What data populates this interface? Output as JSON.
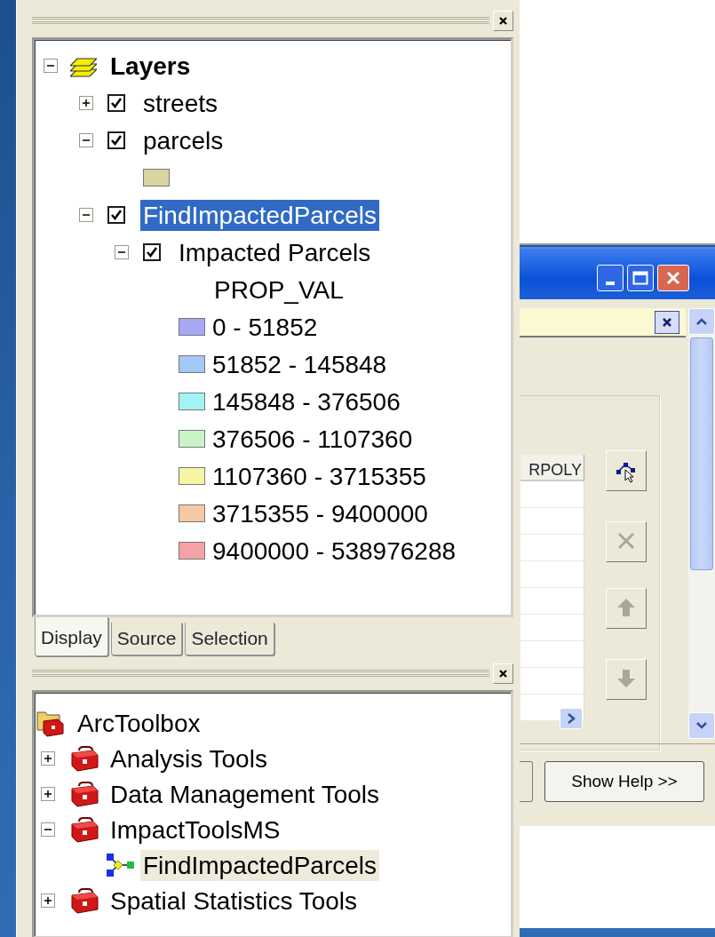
{
  "layers_panel": {
    "tree": [
      {
        "kind": "root",
        "label": "Layers",
        "expanded": true,
        "selected": false,
        "children": [
          {
            "kind": "layer",
            "label": "streets",
            "expanded": false,
            "checked": true,
            "selected": false
          },
          {
            "kind": "layer",
            "label": "parcels",
            "expanded": true,
            "checked": true,
            "selected": false,
            "children": [
              {
                "kind": "swatch",
                "color": "#d7d49e"
              }
            ]
          },
          {
            "kind": "layer",
            "label": "FindImpactedParcels",
            "expanded": true,
            "checked": true,
            "selected": true,
            "children": [
              {
                "kind": "layer",
                "label": "Impacted Parcels",
                "expanded": true,
                "checked": true,
                "selected": false,
                "children": [
                  {
                    "kind": "field",
                    "label": "PROP_VAL"
                  },
                  {
                    "kind": "class",
                    "label": "0 - 51852",
                    "color": "#a7a7f3"
                  },
                  {
                    "kind": "class",
                    "label": "51852 - 145848",
                    "color": "#a3c9f5"
                  },
                  {
                    "kind": "class",
                    "label": "145848 - 376506",
                    "color": "#a2f4f4"
                  },
                  {
                    "kind": "class",
                    "label": "376506 - 1107360",
                    "color": "#c9f4c9"
                  },
                  {
                    "kind": "class",
                    "label": "1107360 - 3715355",
                    "color": "#f5f5a3"
                  },
                  {
                    "kind": "class",
                    "label": "3715355 - 9400000",
                    "color": "#f5c9a3"
                  },
                  {
                    "kind": "class",
                    "label": "9400000 - 538976288",
                    "color": "#f3a3a3"
                  }
                ]
              }
            ]
          }
        ]
      }
    ]
  },
  "tabs": [
    {
      "label": "Display",
      "selected": true
    },
    {
      "label": "Source",
      "selected": false
    },
    {
      "label": "Selection",
      "selected": false
    }
  ],
  "toolbox_panel": {
    "tree": [
      {
        "kind": "root",
        "label": "ArcToolbox",
        "selected": false,
        "children": [
          {
            "kind": "toolbox",
            "label": "Analysis Tools",
            "expanded": false,
            "selected": false
          },
          {
            "kind": "toolbox",
            "label": "Data Management Tools",
            "expanded": false,
            "selected": false
          },
          {
            "kind": "toolbox",
            "label": "ImpactToolsMS",
            "expanded": true,
            "selected": false,
            "children": [
              {
                "kind": "model",
                "label": "FindImpactedParcels",
                "selected": true
              }
            ]
          },
          {
            "kind": "toolbox",
            "label": "Spatial Statistics Tools",
            "expanded": false,
            "selected": false
          }
        ]
      }
    ]
  },
  "dialog": {
    "column_header": "RPOLY",
    "side_buttons": [
      {
        "kind": "edit",
        "disabled": false
      },
      {
        "kind": "delete",
        "disabled": true
      },
      {
        "kind": "up",
        "disabled": true
      },
      {
        "kind": "down",
        "disabled": true
      }
    ],
    "help_button": "Show Help >>"
  }
}
